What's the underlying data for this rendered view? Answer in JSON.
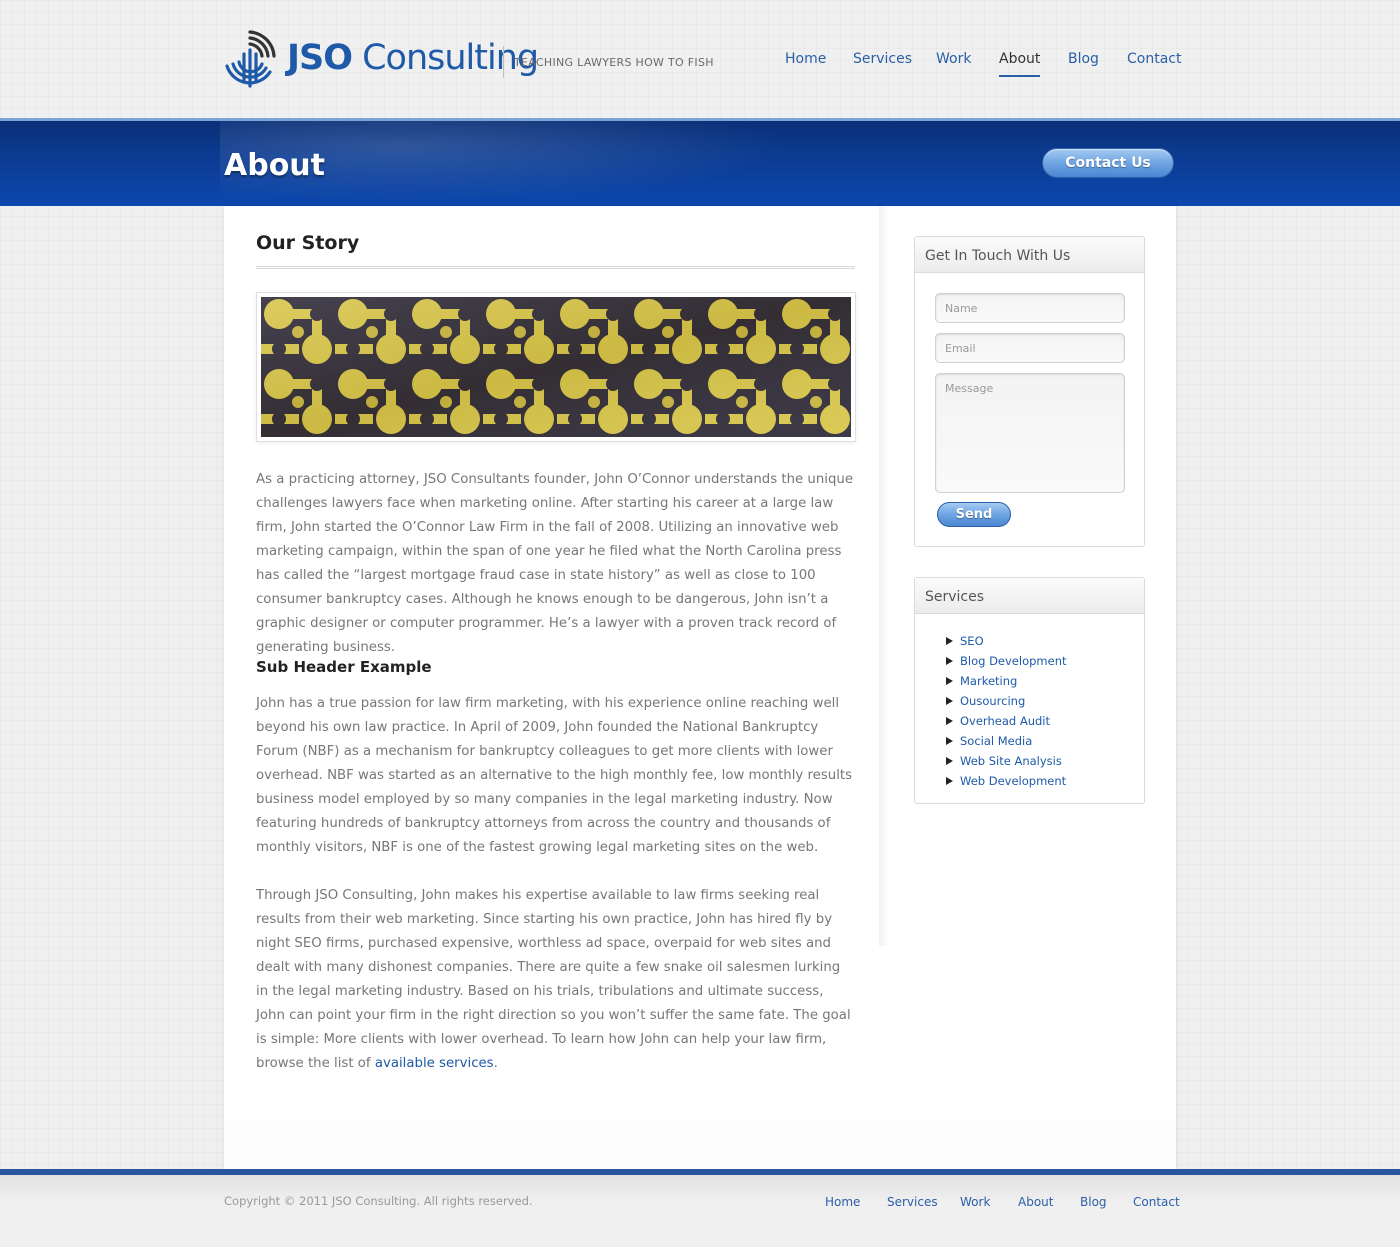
{
  "header": {
    "brand_bold": "JSO",
    "brand_light": " Consulting",
    "tagline": "TEACHING LAWYERS HOW TO FISH",
    "nav": [
      {
        "label": "Home"
      },
      {
        "label": "Services"
      },
      {
        "label": "Work"
      },
      {
        "label": "About",
        "active": true
      },
      {
        "label": "Blog"
      },
      {
        "label": "Contact"
      }
    ]
  },
  "banner": {
    "title": "About",
    "contact_label": "Contact Us"
  },
  "main": {
    "section_title": "Our Story",
    "para1": "As a practicing attorney, JSO Consultants founder, John O’Connor understands the unique challenges lawyers face when marketing online. After starting his career at a large law firm, John started the O’Connor Law Firm in the fall of 2008. Utilizing an innovative web marketing campaign, within the span of one year he filed what the North Carolina press has called the “largest mortgage fraud case in state history” as well as close to 100 consumer bankruptcy cases. Although he knows enough to be dangerous, John isn’t a graphic designer or computer programmer. He’s a lawyer with a proven track record of generating business.",
    "subhead": "Sub Header Example",
    "para2": "John has a true passion for law firm marketing, with his experience online reaching well beyond his own law practice. In April of 2009, John founded the National Bankruptcy Forum (NBF) as a mechanism for bankruptcy colleagues to get more clients with lower overhead. NBF was started as an alternative to the high monthly fee, low monthly results business model employed by so many companies in the legal marketing industry. Now featuring hundreds of bankruptcy attorneys from across the country and thousands of monthly visitors, NBF is one of the fastest growing legal marketing sites on the web.",
    "para3": "Through JSO Consulting, John makes his expertise available to law firms seeking real results from their web marketing. Since starting his own practice, John has hired fly by night SEO firms, purchased expensive, worthless ad space, overpaid for web sites and dealt with many dishonest companies. There are quite a few snake oil salesmen lurking in the legal marketing industry. Based on his trials, tribulations and ultimate success, John can point your firm in the right direction so you won’t suffer the same fate. The goal is simple: More clients with lower overhead. To learn how John can help your law firm, browse the list of ",
    "para3_link": "available services",
    "para3_end": "."
  },
  "sidebar": {
    "contact_title": "Get In Touch With Us",
    "name_placeholder": "Name",
    "email_placeholder": "Email",
    "message_placeholder": "Message",
    "send_label": "Send",
    "services_title": "Services",
    "services": [
      "SEO",
      "Blog Development",
      "Marketing",
      "Ousourcing",
      "Overhead Audit",
      "Social Media",
      "Web Site Analysis",
      "Web Development"
    ]
  },
  "footer": {
    "copyright": "Copyright © 2011 JSO Consulting. All rights reserved.",
    "nav": [
      "Home",
      "Services",
      "Work",
      "About",
      "Blog",
      "Contact"
    ]
  },
  "colors": {
    "brand_blue": "#1e5aa8",
    "banner_dark": "#0a2f77",
    "link": "#2a5fa8",
    "hero_yellow": "#d8c64a",
    "hero_dark": "#2c2838"
  }
}
